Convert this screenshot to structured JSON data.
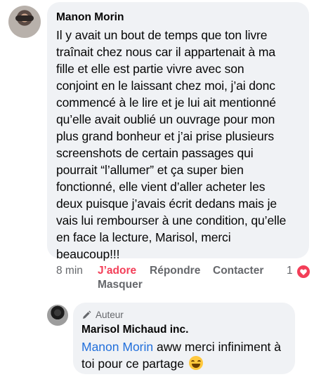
{
  "comment": {
    "author": "Manon Morin",
    "text_lines": [
      "Il y avait un bout de temps que ton livre",
      "traînait chez nous car il appartenait à ma",
      "fille et elle est partie vivre avec son",
      "conjoint en le laissant chez moi, j’ai donc",
      "commencé à le lire et je lui ait mentionné",
      "qu’elle avait oublié un ouvrage pour mon",
      "plus grand bonheur et j’ai prise plusieurs",
      "screenshots de certain passages qui",
      "pourrait “l’allumer” et ça super bien",
      "fonctionné, elle vient d’aller acheter les",
      "deux puisque j’avais écrit dedans mais je",
      "vais lui rembourser à une condition, qu’elle",
      "en face la lecture, Marisol, merci",
      "beaucoup!!!"
    ],
    "time": "8 min",
    "like_label": "J’adore",
    "reply_label": "Répondre",
    "contact_label": "Contacter",
    "hide_label": "Masquer",
    "reaction_count": "1",
    "reaction_icon": "heart-icon",
    "reaction_color": "#f33e58"
  },
  "reply": {
    "badge_label": "Auteur",
    "badge_icon": "pencil-icon",
    "author": "Marisol Michaud inc.",
    "mention": "Manon Morin",
    "text_line1_rest": " aww merci infiniment à",
    "text_line2": "toi pour ce partage",
    "emoji": "grinning-face-emoji"
  },
  "colors": {
    "bubble_bg": "#f0f2f5",
    "secondary_text": "#65676b",
    "mention": "#216fdb"
  }
}
